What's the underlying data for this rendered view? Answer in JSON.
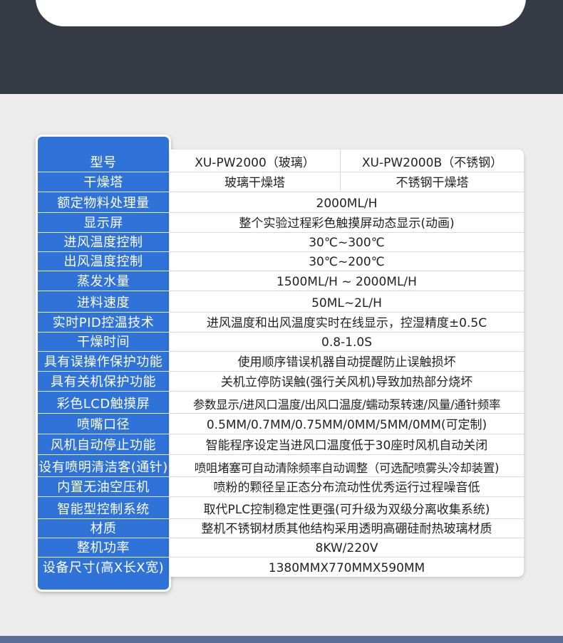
{
  "colors": {
    "label_bg": "#2f73d9",
    "dark_band": "#353a45",
    "page_bg": "#ececec"
  },
  "specs": [
    {
      "label": "型号",
      "values": [
        "XU-PW2000（玻璃）",
        "XU-PW2000B（不锈钢）"
      ]
    },
    {
      "label": "干燥塔",
      "values": [
        "玻璃干燥塔",
        "不锈钢干燥塔"
      ]
    },
    {
      "label": "额定物料处理量",
      "values": [
        "2000ML/H"
      ]
    },
    {
      "label": "显示屏",
      "values": [
        "整个实验过程彩色触摸屏动态显示(动画)"
      ]
    },
    {
      "label": "进风温度控制",
      "values": [
        "30℃~300℃"
      ]
    },
    {
      "label": "出风温度控制",
      "values": [
        "30℃~200℃"
      ]
    },
    {
      "label": "蒸发水量",
      "values": [
        "1500ML/H ~ 2000ML/H"
      ]
    },
    {
      "label": "进料速度",
      "values": [
        "50ML~2L/H"
      ]
    },
    {
      "label": "实时PID控温技术",
      "values": [
        "进风温度和出风温度实时在线显示，控湿精度±0.5C"
      ]
    },
    {
      "label": "干燥时间",
      "values": [
        "0.8-1.0S"
      ]
    },
    {
      "label": "具有误操作保护功能",
      "values": [
        "使用顺序错误机器自动提醒防止误触损坏"
      ]
    },
    {
      "label": "具有关机保护功能",
      "values": [
        "关机立停防误触(强行关风机)导致加热部分烧坏"
      ]
    },
    {
      "label": "彩色LCD触摸屏",
      "values": [
        "参数显示/进风口温度/出风口温度/蠕动泵转速/风量/通针频率"
      ]
    },
    {
      "label": "喷嘴口径",
      "values": [
        "0.5MM/0.7MM/0.75MM/0MM/5MM/0MM(可定制)"
      ]
    },
    {
      "label": "风机自动停止功能",
      "values": [
        "智能程序设定当进风口温度低于30座时风机自动关闭"
      ]
    },
    {
      "label": "设有喷明清洁客(通针)",
      "values": [
        "喷咀堵塞可自动清除频率自动调整（可选配喷雾头冷却装置)"
      ]
    },
    {
      "label": "内置无油空压机",
      "values": [
        "喷粉的颗径呈正态分布流动性优秀运行过程噪音低"
      ]
    },
    {
      "label": "智能型控制系统",
      "values": [
        "取代PLC控制稳定性更强(可升级为双级分离收集系统)"
      ]
    },
    {
      "label": "材质",
      "values": [
        "整机不锈钢材质其他结构采用透明高硼硅耐热玻璃材质"
      ]
    },
    {
      "label": "整机功率",
      "values": [
        "8KW/220V"
      ]
    },
    {
      "label": "设备尺寸(高X长X宽)",
      "values": [
        "1380MMX770MMX590MM"
      ]
    }
  ]
}
